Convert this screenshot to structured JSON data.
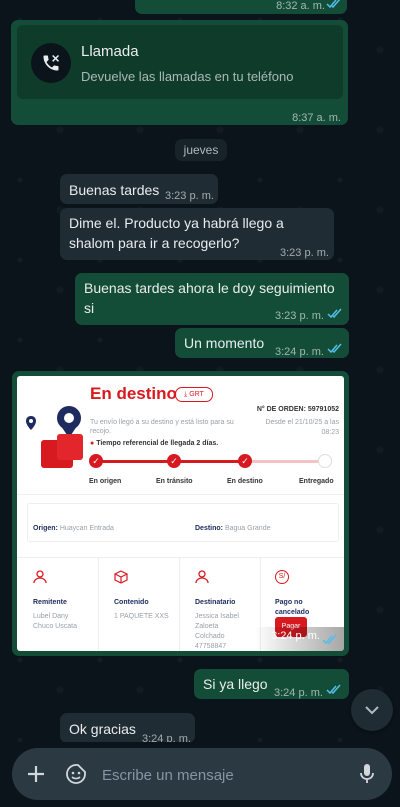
{
  "top_partial": {
    "time": "8:32 a. m."
  },
  "call": {
    "title": "Llamada",
    "subtitle": "Devuelve las llamadas en tu teléfono",
    "time": "8:37 a. m."
  },
  "day_label": "jueves",
  "messages": [
    {
      "text": "Buenas tardes",
      "time": "3:23 p. m."
    },
    {
      "line1": "Dime el. Producto ya habrá llego a",
      "line2": "shalom para ir a recogerlo?",
      "time": "3:23 p. m."
    },
    {
      "line1": "Buenas tardes ahora le doy seguimiento",
      "line2": "si",
      "time": "3:23 p. m."
    },
    {
      "text": "Un momento",
      "time": "3:24 p. m."
    },
    {
      "text": "Si ya llego",
      "time": "3:24 p. m."
    },
    {
      "text": "Ok gracias",
      "time": "3:24 p. m."
    }
  ],
  "tracking": {
    "status": "En destino",
    "grt_label": "GRT",
    "order_label": "N° DE ORDEN: 59791052",
    "desc_line1": "Tu envío llegó a su destino y está listo para su",
    "desc_line2": "recojo.",
    "since_line1": "Desde el 21/10/25 a las",
    "since_line2": "08:23",
    "eta": "Tiempo referencial de llegada 2 días.",
    "steps": [
      "En origen",
      "En tránsito",
      "En destino",
      "Entregado"
    ],
    "origin_label": "Origen:",
    "origin_value": "Huaycan Entrada",
    "dest_label": "Destino:",
    "dest_value": "Bagua Grande",
    "sender_label": "Remitente",
    "sender_line1": "Lubel Dany",
    "sender_line2": "Chuco Uscata",
    "content_label": "Contenido",
    "content_value": "1 PAQUETE XXS",
    "recipient_label": "Destinatario",
    "recipient_line1": "Jessica Isabel",
    "recipient_line2": "Zaloeta",
    "recipient_line3": "Colchado",
    "recipient_line4": "47758847",
    "payment_line1": "Pago no",
    "payment_line2": "cancelado",
    "pay_button": "Pagar",
    "time": "3:24 p. m."
  },
  "composer": {
    "placeholder": "Escribe un mensaje"
  },
  "colors": {
    "outgoing": "#144d37",
    "incoming": "#202c33",
    "read_ticks": "#53bdeb",
    "brand_red": "#d71920"
  }
}
